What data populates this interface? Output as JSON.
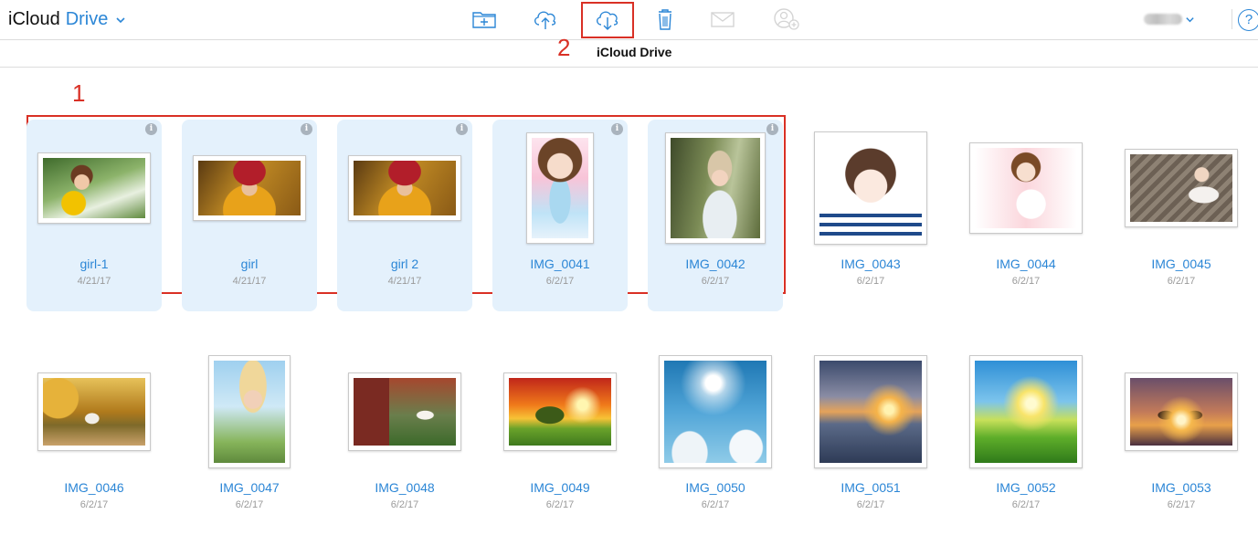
{
  "header": {
    "app_name": "iCloud",
    "section_name": "Drive",
    "subtitle": "iCloud Drive",
    "help_label": "?",
    "toolbar": [
      {
        "name": "new-folder-icon",
        "enabled": true
      },
      {
        "name": "upload-icon",
        "enabled": true
      },
      {
        "name": "download-icon",
        "enabled": true
      },
      {
        "name": "trash-icon",
        "enabled": true
      },
      {
        "name": "mail-icon",
        "enabled": false
      },
      {
        "name": "share-person-icon",
        "enabled": false
      }
    ]
  },
  "annotations": {
    "label_1": "1",
    "label_2": "2",
    "color": "#d93025"
  },
  "colors": {
    "accent": "#2b86d6",
    "selected_tile": "#e4f1fc",
    "date": "#9a9a9a"
  },
  "files": [
    {
      "name": "girl-1",
      "date": "4/21/17",
      "selected": true
    },
    {
      "name": "girl",
      "date": "4/21/17",
      "selected": true
    },
    {
      "name": "girl 2",
      "date": "4/21/17",
      "selected": true
    },
    {
      "name": "IMG_0041",
      "date": "6/2/17",
      "selected": true
    },
    {
      "name": "IMG_0042",
      "date": "6/2/17",
      "selected": true
    },
    {
      "name": "IMG_0043",
      "date": "6/2/17",
      "selected": false
    },
    {
      "name": "IMG_0044",
      "date": "6/2/17",
      "selected": false
    },
    {
      "name": "IMG_0045",
      "date": "6/2/17",
      "selected": false
    },
    {
      "name": "IMG_0046",
      "date": "6/2/17",
      "selected": false
    },
    {
      "name": "IMG_0047",
      "date": "6/2/17",
      "selected": false
    },
    {
      "name": "IMG_0048",
      "date": "6/2/17",
      "selected": false
    },
    {
      "name": "IMG_0049",
      "date": "6/2/17",
      "selected": false
    },
    {
      "name": "IMG_0050",
      "date": "6/2/17",
      "selected": false
    },
    {
      "name": "IMG_0051",
      "date": "6/2/17",
      "selected": false
    },
    {
      "name": "IMG_0052",
      "date": "6/2/17",
      "selected": false
    },
    {
      "name": "IMG_0053",
      "date": "6/2/17",
      "selected": false
    }
  ]
}
